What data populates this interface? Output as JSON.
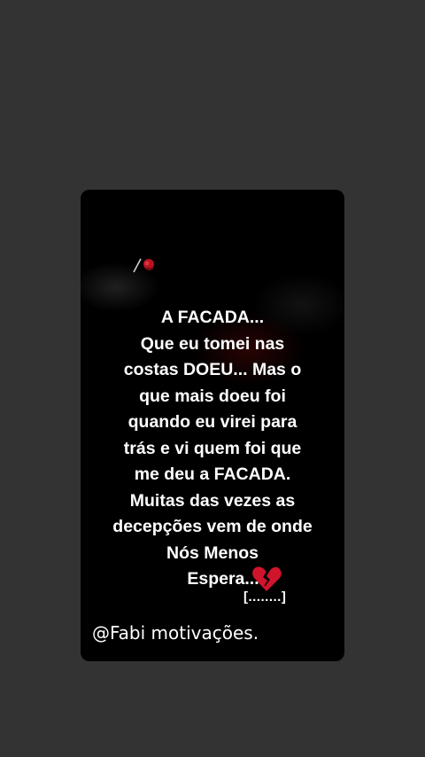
{
  "story": {
    "lines": [
      "A FACADA...",
      "Que eu tomei nas",
      "costas DOEU... Mas o",
      "que mais doeu foi",
      "quando eu virei para",
      "trás e vi quem foi que",
      "me deu a FACADA.",
      "Muitas das vezes as",
      "decepções vem de onde",
      "Nós Menos",
      "Espera..."
    ],
    "ellipsis": "[........]",
    "author": "@Fabi motivações."
  },
  "icons": {
    "rose": "rose-icon",
    "broken_heart": "broken-heart-icon"
  },
  "colors": {
    "page_background": "#333333",
    "card_background": "#000000",
    "text": "#ffffff",
    "heart": "#d0142c"
  }
}
